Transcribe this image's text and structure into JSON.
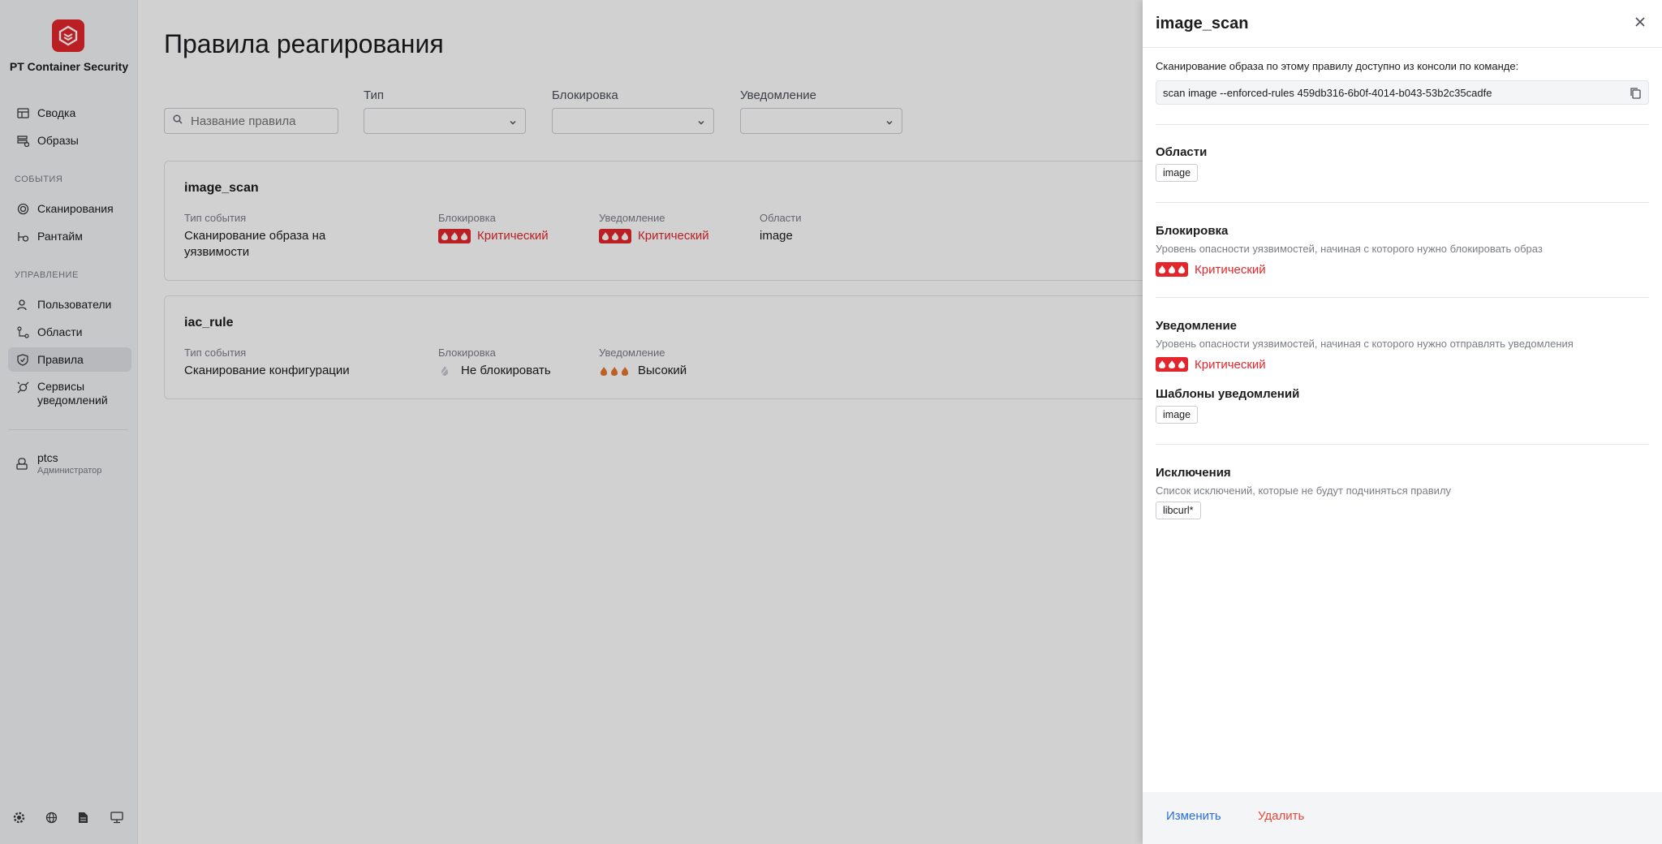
{
  "app": {
    "product_name": "PT Container Security"
  },
  "sidebar": {
    "items_top": [
      {
        "label": "Сводка",
        "icon": "table-icon"
      },
      {
        "label": "Образы",
        "icon": "stack-icon"
      }
    ],
    "section_events": "СОБЫТИЯ",
    "items_events": [
      {
        "label": "Сканирования",
        "icon": "scan-icon"
      },
      {
        "label": "Рантайм",
        "icon": "runtime-icon"
      }
    ],
    "section_manage": "УПРАВЛЕНИЕ",
    "items_manage": [
      {
        "label": "Пользователи",
        "icon": "users-icon"
      },
      {
        "label": "Области",
        "icon": "scopes-icon"
      },
      {
        "label": "Правила",
        "icon": "shield-icon",
        "active": true
      },
      {
        "label_line1": "Сервисы",
        "label_line2": "уведомлений",
        "icon": "notification-services-icon"
      }
    ],
    "user": {
      "name": "ptcs",
      "role": "Администратор"
    },
    "bottom_icons": [
      "gear-icon",
      "globe-icon",
      "document-icon",
      "monitor-icon"
    ]
  },
  "main": {
    "title": "Правила реагирования",
    "filters": {
      "search_placeholder": "Название правила",
      "type_label": "Тип",
      "block_label": "Блокировка",
      "notify_label": "Уведомление"
    },
    "rules": [
      {
        "name": "image_scan",
        "event_type_label": "Тип события",
        "event_type_line1": "Сканирование образа на",
        "event_type_line2": "уязвимости",
        "block_label": "Блокировка",
        "block_value": "Критический",
        "notify_label": "Уведомление",
        "notify_value": "Критический",
        "scopes_label": "Области",
        "scopes_value": "image"
      },
      {
        "name": "iac_rule",
        "event_type_label": "Тип события",
        "event_type_line1": "Сканирование конфигурации",
        "block_label": "Блокировка",
        "block_value": "Не блокировать",
        "notify_label": "Уведомление",
        "notify_value": "Высокий"
      }
    ]
  },
  "drawer": {
    "title": "image_scan",
    "console_hint": "Сканирование образа по этому правилу доступно из консоли по команде:",
    "command": "scan image --enforced-rules 459db316-6b0f-4014-b043-53b2c35cadfe",
    "scopes_title": "Области",
    "scopes_tag": "image",
    "block_title": "Блокировка",
    "block_desc": "Уровень опасности уязвимостей, начиная с которого нужно блокировать образ",
    "block_value": "Критический",
    "notify_title": "Уведомление",
    "notify_desc": "Уровень опасности уязвимостей, начиная с которого нужно отправлять уведомления",
    "notify_value": "Критический",
    "templates_title": "Шаблоны уведомлений",
    "templates_tag": "image",
    "exceptions_title": "Исключения",
    "exceptions_desc": "Список исключений, которые не будут подчиняться правилу",
    "exceptions_tag": "libcurl*",
    "edit_label": "Изменить",
    "delete_label": "Удалить"
  },
  "colors": {
    "critical": "#e3262b",
    "high_flame": "#e8742c",
    "link_blue": "#2a6fdb",
    "delete_red": "#e5483a"
  }
}
